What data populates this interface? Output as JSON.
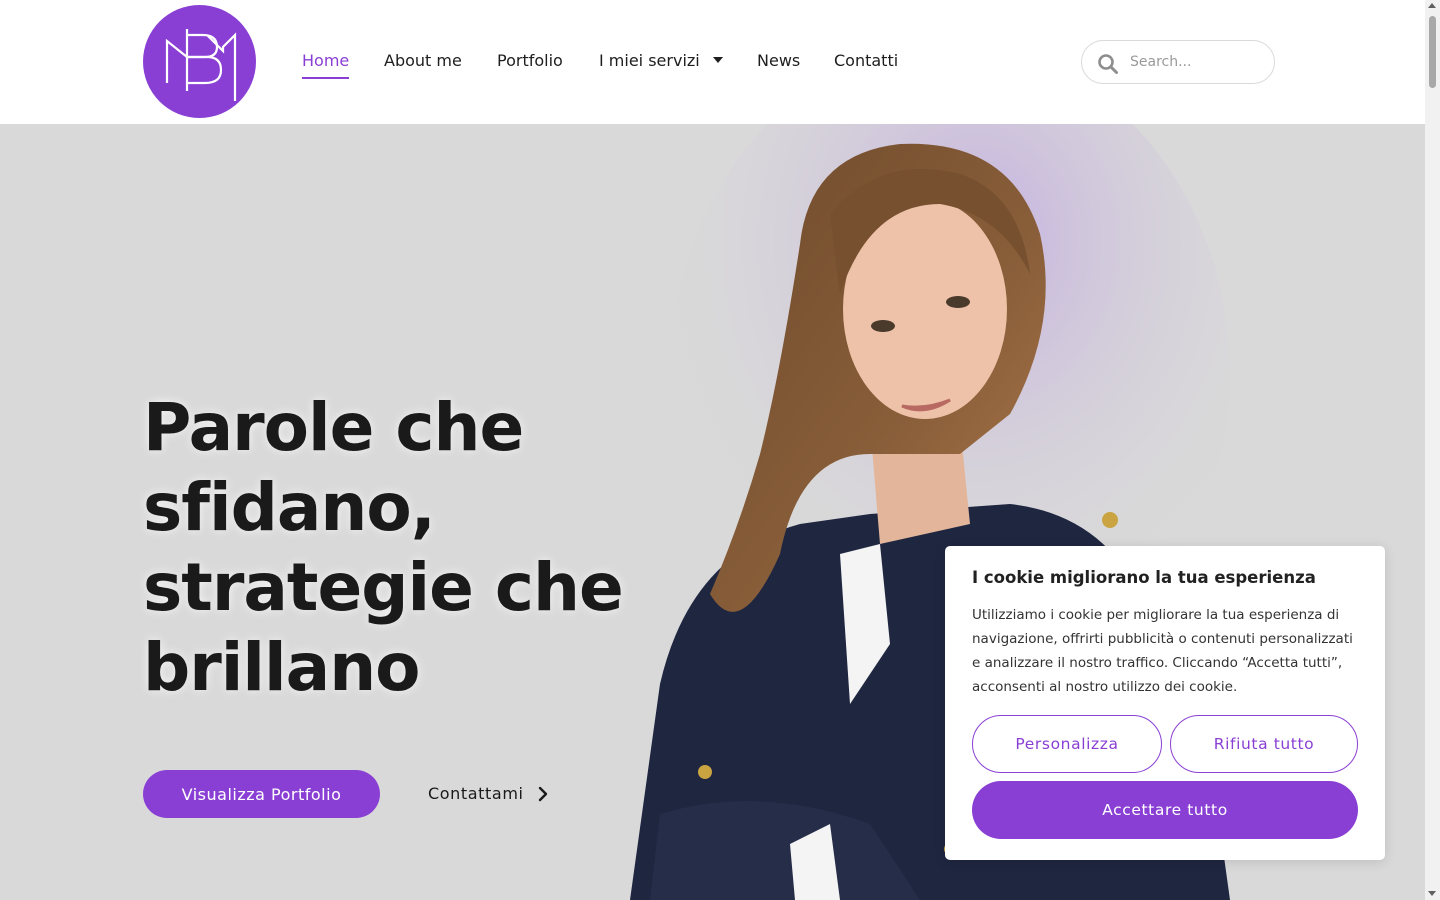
{
  "brand": {
    "accent": "#8a3fd4",
    "logo_letters": "MB"
  },
  "nav": {
    "items": [
      {
        "label": "Home",
        "active": true
      },
      {
        "label": "About me",
        "active": false
      },
      {
        "label": "Portfolio",
        "active": false
      },
      {
        "label": "I miei servizi",
        "active": false,
        "dropdown": true
      },
      {
        "label": "News",
        "active": false
      },
      {
        "label": "Contatti",
        "active": false
      }
    ]
  },
  "search": {
    "placeholder": "Search...",
    "value": "",
    "icon": "search-icon"
  },
  "hero": {
    "title_lines": [
      "Parole che",
      "sfidano,",
      "strategie che",
      "brillano"
    ],
    "primary_button": "Visualizza Portfolio",
    "secondary_link": "Contattami",
    "secondary_icon": "chevron-right-icon"
  },
  "cookie": {
    "title": "I cookie migliorano la tua esperienza",
    "body": "Utilizziamo i cookie per migliorare la tua esperienza di navigazione, offrirti pubblicità o contenuti personalizzati e analizzare il nostro traffico. Cliccando “Accetta tutti”, acconsenti al nostro utilizzo dei cookie.",
    "customize_label": "Personalizza",
    "reject_label": "Rifiuta tutto",
    "accept_label": "Accettare tutto"
  }
}
